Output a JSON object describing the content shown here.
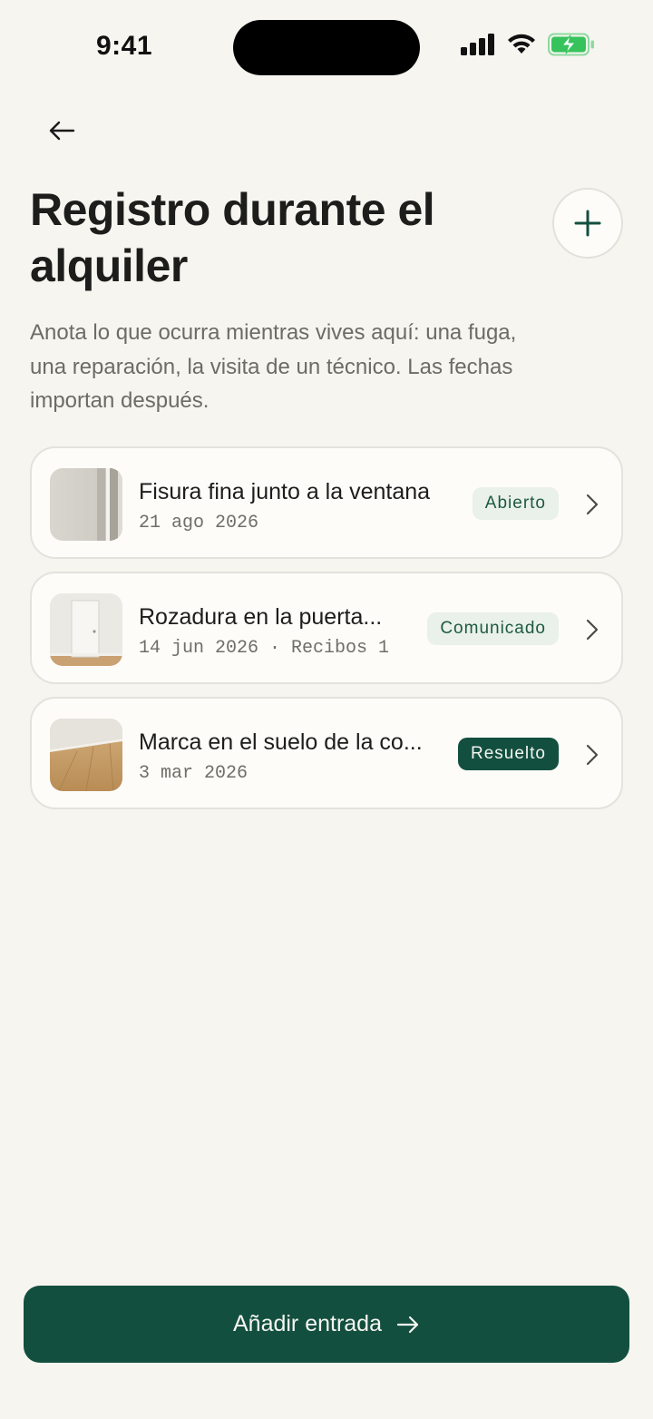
{
  "status_bar": {
    "time": "9:41"
  },
  "header": {
    "title": "Registro durante el alquiler",
    "intro": "Anota lo que ocurra mientras vives aquí: una fuga, una reparación, la visita de un técnico. Las fechas importan después."
  },
  "entries": [
    {
      "title": "Fisura fina junto a la ventana",
      "meta": "21 ago 2026",
      "status": "Abierto",
      "status_style": "light"
    },
    {
      "title": "Rozadura en la puerta...",
      "meta": "14 jun 2026 · Recibos 1",
      "status": "Comunicado",
      "status_style": "light"
    },
    {
      "title": "Marca en el suelo de la co...",
      "meta": "3 mar 2026",
      "status": "Resuelto",
      "status_style": "dark"
    }
  ],
  "cta": {
    "label": "Añadir entrada"
  },
  "colors": {
    "accent": "#134f3f",
    "background": "#f6f5f0",
    "badge_light_bg": "#eaf0ea",
    "battery": "#36c35c"
  },
  "icons": {
    "back": "arrow-left-icon",
    "add": "plus-icon",
    "chevron": "chevron-right-icon",
    "cta": "arrow-right-icon"
  }
}
